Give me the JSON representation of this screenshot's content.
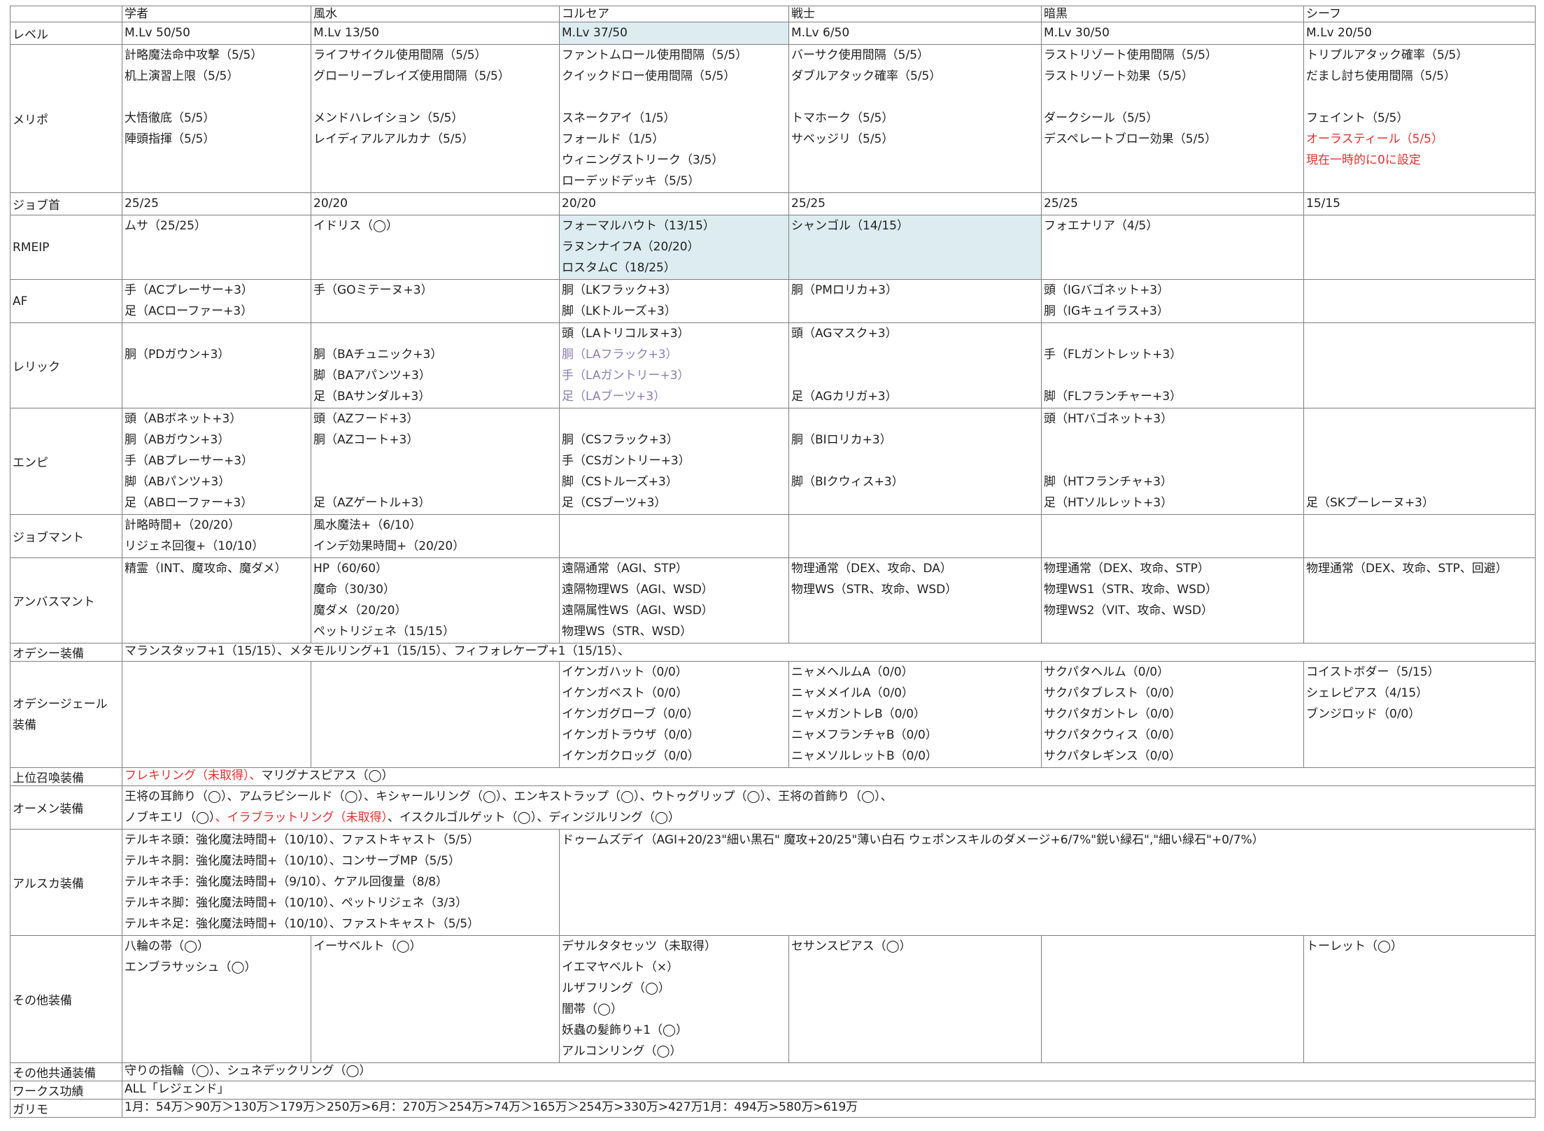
{
  "columns": [
    "学者",
    "風水",
    "コルセア",
    "戦士",
    "暗黒",
    "シーフ"
  ],
  "colors": {
    "red": "#e03030",
    "highlight": "#dcecf1",
    "purple": "#8a7fb0"
  },
  "rows": [
    {
      "label": "レベル",
      "cells": [
        [
          "M.Lv 50/50"
        ],
        [
          "M.Lv 13/50"
        ],
        [
          "M.Lv 37/50"
        ],
        [
          "M.Lv 6/50"
        ],
        [
          "M.Lv 30/50"
        ],
        [
          "M.Lv 20/50"
        ]
      ]
    },
    {
      "label": "メリポ",
      "cells": [
        [
          "計略魔法命中攻撃（5/5）",
          "机上演習上限（5/5）",
          "",
          "大悟徹底（5/5）",
          "陣頭指揮（5/5）",
          "",
          ""
        ],
        [
          "ライフサイクル使用間隔（5/5）",
          "グローリーブレイズ使用間隔（5/5）",
          "",
          "メンドハレイション（5/5）",
          "レイディアルアルカナ（5/5）",
          "",
          ""
        ],
        [
          "ファントムロール使用間隔（5/5）",
          "クイックドロー使用間隔（5/5）",
          "",
          "スネークアイ（1/5）",
          "フォールド（1/5）",
          "ウィニングストリーク（3/5）",
          "ローデッドデッキ（5/5）"
        ],
        [
          "バーサク使用間隔（5/5）",
          "ダブルアタック確率（5/5）",
          "",
          "トマホーク（5/5）",
          "サベッジリ（5/5）",
          "",
          ""
        ],
        [
          "ラストリゾート使用間隔（5/5）",
          "ラストリゾート効果（5/5）",
          "",
          "ダークシール（5/5）",
          "デスペレートブロー効果（5/5）",
          "",
          ""
        ],
        [
          "トリプルアタック確率（5/5）",
          "だまし討ち使用間隔（5/5）",
          "",
          "フェイント（5/5）",
          "オーラスティール（5/5）",
          "現在一時的に0に設定",
          ""
        ]
      ]
    },
    {
      "label": "ジョブ首",
      "cells": [
        [
          "25/25"
        ],
        [
          "20/20"
        ],
        [
          "20/20"
        ],
        [
          "25/25"
        ],
        [
          "25/25"
        ],
        [
          "15/15"
        ]
      ]
    },
    {
      "label": "RMEIP",
      "cells": [
        [
          "ムサ（25/25）",
          "",
          ""
        ],
        [
          "イドリス（◯）",
          "",
          ""
        ],
        [
          "フォーマルハウト（13/15）",
          "ラヌンナイフA（20/20）",
          "ロスタムC（18/25）"
        ],
        [
          "シャンゴル（14/15）",
          "",
          ""
        ],
        [
          "フォエナリア（4/5）",
          "",
          ""
        ],
        [
          "",
          "",
          ""
        ]
      ]
    },
    {
      "label": "AF",
      "cells": [
        [
          "手（ACプレーサー+3）",
          "足（ACローファー+3）"
        ],
        [
          "手（GOミテーヌ+3）",
          ""
        ],
        [
          "胴（LKフラック+3）",
          "脚（LKトルーズ+3）"
        ],
        [
          "胴（PMロリカ+3）",
          ""
        ],
        [
          "頭（IGバゴネット+3）",
          "胴（IGキュイラス+3）"
        ],
        [
          "",
          ""
        ]
      ]
    },
    {
      "label": "レリック",
      "cells": [
        [
          "",
          "胴（PDガウン+3）",
          "",
          ""
        ],
        [
          "",
          "胴（BAチュニック+3）",
          "脚（BAアパンツ+3）",
          "足（BAサンダル+3）"
        ],
        [
          "頭（LAトリコルヌ+3）",
          "胴（LAフラック+3）",
          "手（LAガントリー+3）",
          "足（LAブーツ+3）"
        ],
        [
          "頭（AGマスク+3）",
          "",
          "",
          "足（AGカリガ+3）"
        ],
        [
          "",
          "手（FLガントレット+3）",
          "",
          "脚（FLフランチャー+3）"
        ],
        [
          "",
          "",
          "",
          ""
        ]
      ]
    },
    {
      "label": "エンピ",
      "cells": [
        [
          "頭（ABボネット+3）",
          "胴（ABガウン+3）",
          "手（ABプレーサー+3）",
          "脚（ABパンツ+3）",
          "足（ABローファー+3）"
        ],
        [
          "頭（AZフード+3）",
          "胴（AZコート+3）",
          "",
          "",
          "足（AZゲートル+3）"
        ],
        [
          "",
          "胴（CSフラック+3）",
          "手（CSガントリー+3）",
          "脚（CSトルーズ+3）",
          "足（CSブーツ+3）"
        ],
        [
          "",
          "胴（BIロリカ+3）",
          "",
          "脚（BIクウィス+3）",
          ""
        ],
        [
          "頭（HTバゴネット+3）",
          "",
          "",
          "脚（HTフランチャ+3）",
          "足（HTソルレット+3）"
        ],
        [
          "",
          "",
          "",
          "",
          "足（SKプーレーヌ+3）"
        ]
      ]
    },
    {
      "label": "ジョブマント",
      "cells": [
        [
          "計略時間+（20/20）",
          "リジェネ回復+（10/10）"
        ],
        [
          "風水魔法+（6/10）",
          "インデ効果時間+（20/20）"
        ],
        [
          "",
          ""
        ],
        [
          "",
          ""
        ],
        [
          "",
          ""
        ],
        [
          "",
          ""
        ]
      ]
    },
    {
      "label": "アンバスマント",
      "cells": [
        [
          "精霊（INT、魔攻命、魔ダメ）",
          "",
          "",
          ""
        ],
        [
          "HP（60/60）",
          "魔命（30/30）",
          "魔ダメ（20/20）",
          "ペットリジェネ（15/15）"
        ],
        [
          "遠隔通常（AGI、STP）",
          "遠隔物理WS（AGI、WSD）",
          "遠隔属性WS（AGI、WSD）",
          "物理WS（STR、WSD）"
        ],
        [
          "物理通常（DEX、攻命、DA）",
          "物理WS（STR、攻命、WSD）",
          "",
          ""
        ],
        [
          "物理通常（DEX、攻命、STP）",
          "物理WS1（STR、攻命、WSD）",
          "物理WS2（VIT、攻命、WSD）",
          ""
        ],
        [
          "物理通常（DEX、攻命、STP、回避）",
          "",
          "",
          ""
        ]
      ]
    },
    {
      "label": "オデシー装備",
      "span": "マランスタッフ+1（15/15）、メタモルリング+1（15/15）、フィフォレケープ+1（15/15）、"
    },
    {
      "label": "オデシージェール装備",
      "label_lines": [
        "オデシージェール",
        "装備"
      ],
      "cells": [
        [
          "",
          "",
          "",
          "",
          ""
        ],
        [
          "",
          "",
          "",
          "",
          ""
        ],
        [
          "イケンガハット（0/0）",
          "イケンガベスト（0/0）",
          "イケンガグローブ（0/0）",
          "イケンガトラウザ（0/0）",
          "イケンガクロッグ（0/0）"
        ],
        [
          "ニャメヘルムA（0/0）",
          "ニャメメイルA（0/0）",
          "ニャメガントレB（0/0）",
          "ニャメフランチャB（0/0）",
          "ニャメソルレットB（0/0）"
        ],
        [
          "サクパタヘルム（0/0）",
          "サクパタブレスト（0/0）",
          "サクパタガントレ（0/0）",
          "サクパタクウィス（0/0）",
          "サクパタレギンス（0/0）"
        ],
        [
          "コイストボダー（5/15）",
          "シェレピアス（4/15）",
          "ブンジロッド（0/0）",
          "",
          ""
        ]
      ]
    },
    {
      "label": "上位召喚装備",
      "segments": [
        {
          "text": "フレキリング（未取得）、",
          "red": true
        },
        {
          "text": "マリグナスピアス（◯）",
          "red": false
        }
      ]
    },
    {
      "label": "オーメン装備",
      "lines": [
        [
          {
            "text": "王将の耳飾り（◯）、アムラピシールド（◯）、キシャールリング（◯）、エンキストラップ（◯）、ウトゥグリップ（◯）、王将の首飾り（◯）、",
            "red": false
          }
        ],
        [
          {
            "text": "ノブキエリ（◯）",
            "red": false
          },
          {
            "text": "、イラブラットリング（未取得）",
            "red": true
          },
          {
            "text": "、イスクルゴルゲット（◯）",
            "red": false
          },
          {
            "text": "、ディンジルリング（◯）",
            "red": false
          }
        ]
      ]
    },
    {
      "label": "アルスカ装備",
      "left": [
        "テルキネ頭：強化魔法時間+（10/10）、ファストキャスト（5/5）",
        "テルキネ胴：強化魔法時間+（10/10）、コンサーブMP（5/5）",
        "テルキネ手：強化魔法時間+（9/10）、ケアル回復量（8/8）",
        "テルキネ脚：強化魔法時間+（10/10）、ペットリジェネ（3/3）",
        "テルキネ足：強化魔法時間+（10/10）、ファストキャスト（5/5）"
      ],
      "right": "ドゥームズデイ（AGI+20/23\"細い黒石\" 魔攻+20/25\"薄い白石 ウェポンスキルのダメージ+6/7%\"鋭い緑石\",\"細い緑石\"+0/7%）"
    },
    {
      "label": "その他装備",
      "cells": [
        [
          "八輪の帯（◯）",
          "エンブラサッシュ（◯）",
          "",
          "",
          "",
          ""
        ],
        [
          "イーサベルト（◯）",
          "",
          "",
          "",
          "",
          ""
        ],
        [
          "デサルタタセッツ（未取得）",
          "イエマヤベルト（×）",
          "ルザフリング（◯）",
          "闇帯（◯）",
          "妖蟲の髪飾り+1（◯）",
          "アルコンリング（◯）"
        ],
        [
          "セサンスピアス（◯）",
          "",
          "",
          "",
          "",
          ""
        ],
        [
          "",
          "",
          "",
          "",
          "",
          ""
        ],
        [
          "トーレット（◯）",
          "",
          "",
          "",
          "",
          ""
        ]
      ]
    },
    {
      "label": "その他共通装備",
      "span": "守りの指輪（◯）、シュネデックリング（◯）"
    },
    {
      "label": "ワークス功績",
      "span": "ALL「レジェンド」"
    },
    {
      "label": "ガリモ",
      "span": "1月：54万＞90万＞130万＞179万＞250万>6月：270万＞254万>74万＞165万＞254万>330万>427万1月：494万>580万>619万"
    }
  ]
}
